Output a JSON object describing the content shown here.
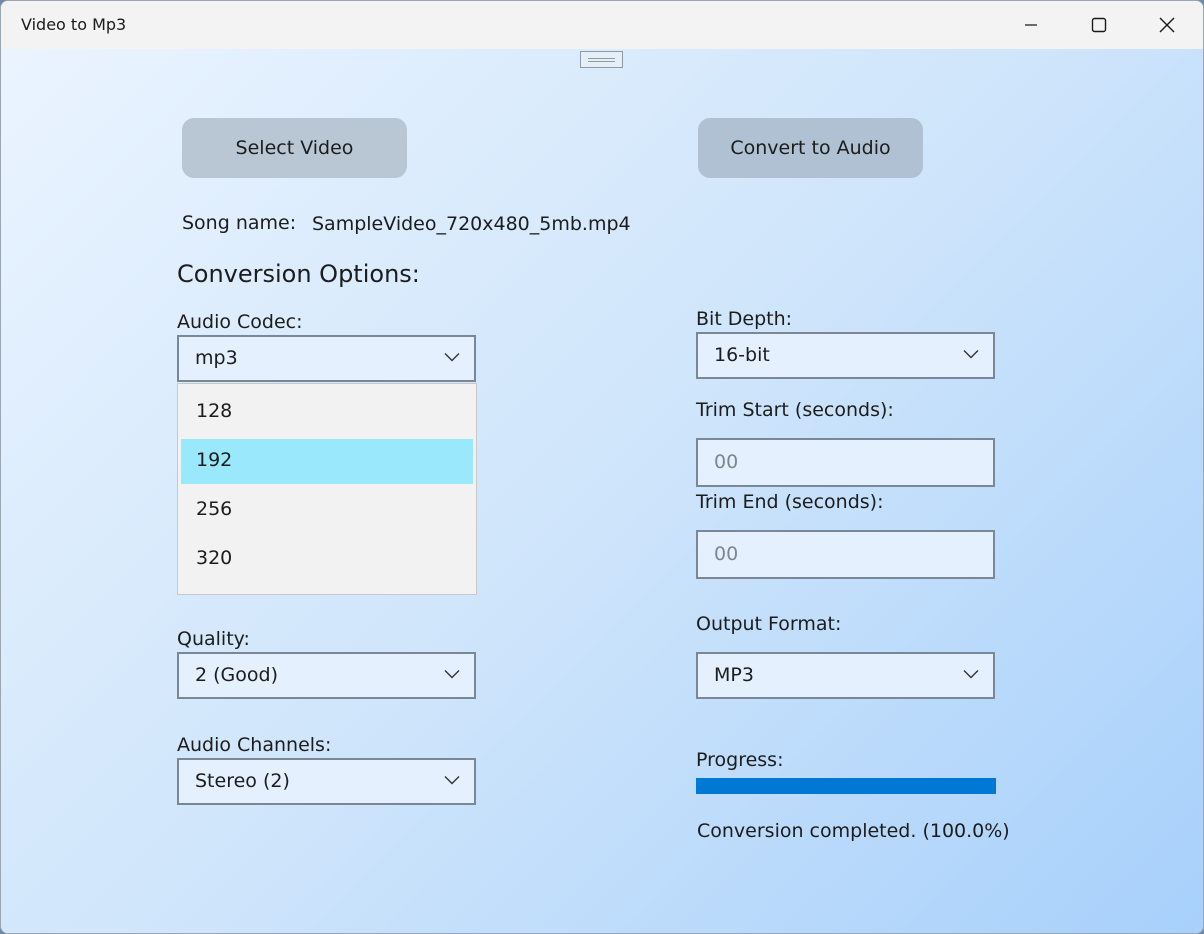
{
  "window": {
    "title": "Video to Mp3"
  },
  "actions": {
    "select_video": "Select Video",
    "convert": "Convert to Audio"
  },
  "song": {
    "label": "Song name:",
    "value": "SampleVideo_720x480_5mb.mp4"
  },
  "options_heading": "Conversion Options:",
  "audio_codec": {
    "label": "Audio Codec:",
    "value": "mp3"
  },
  "bitrate_dropdown": {
    "items": [
      "128",
      "192",
      "256",
      "320"
    ],
    "selected": "192"
  },
  "quality": {
    "label": "Quality:",
    "value": "2 (Good)"
  },
  "audio_channels": {
    "label": "Audio Channels:",
    "value": "Stereo (2)"
  },
  "bit_depth": {
    "label": "Bit Depth:",
    "value": "16-bit"
  },
  "trim_start": {
    "label": "Trim Start (seconds):",
    "placeholder": "00"
  },
  "trim_end": {
    "label": "Trim End (seconds):",
    "placeholder": "00"
  },
  "output_format": {
    "label": "Output Format:",
    "value": "MP3"
  },
  "progress": {
    "label": "Progress:",
    "value": 1.0,
    "status": "Conversion completed. (100.0%)"
  },
  "colors": {
    "accent": "#0078d4",
    "dropdown_highlight": "#99e8fb",
    "button_bg": "#b9c7d5"
  }
}
